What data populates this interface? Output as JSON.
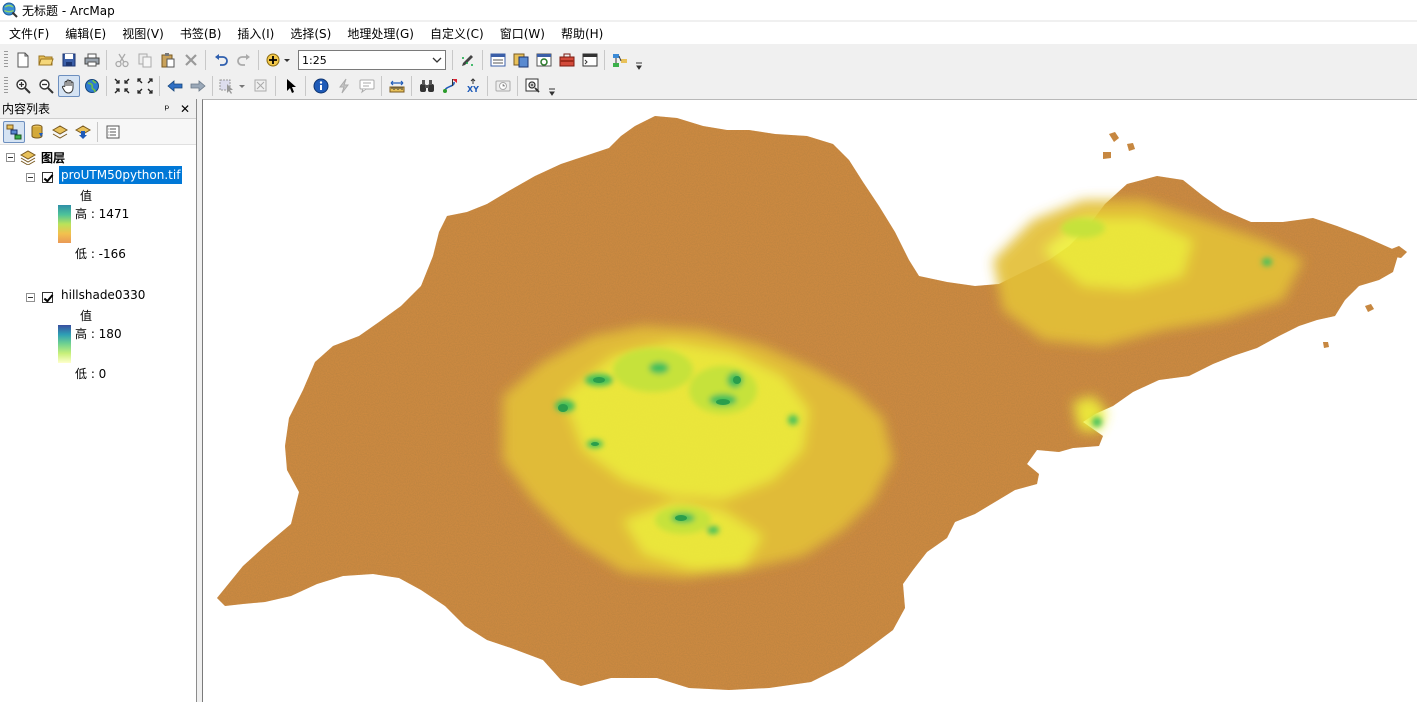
{
  "window": {
    "title": "无标题 - ArcMap"
  },
  "menu": [
    "文件(F)",
    "编辑(E)",
    "视图(V)",
    "书签(B)",
    "插入(I)",
    "选择(S)",
    "地理处理(G)",
    "自定义(C)",
    "窗口(W)",
    "帮助(H)"
  ],
  "toolbar": {
    "scale_value": "1:25"
  },
  "toc": {
    "title": "内容列表",
    "pin_glyph": "ᵖ",
    "close_glyph": "✕",
    "root_label": "图层",
    "layers": [
      {
        "name": "proUTM50python.tif",
        "checked": true,
        "selected": true,
        "legend_title": "值",
        "high_label": "高 : 1471",
        "low_label": "低 : -166",
        "ramp_colors": [
          "#2f8fa8",
          "#4dc29a",
          "#b9e35a",
          "#f2c14e",
          "#ea9a56"
        ]
      },
      {
        "name": "hillshade0330",
        "checked": true,
        "selected": false,
        "legend_title": "值",
        "high_label": "高 : 180",
        "low_label": "低 : 0",
        "ramp_colors": [
          "#3a4fa0",
          "#2e9fb5",
          "#72d38f",
          "#c9f07a",
          "#ffffcc"
        ]
      }
    ]
  },
  "map": {
    "background": "#ffffff",
    "land_color": "#d38c43",
    "highland_colors": [
      "#e3c039",
      "#eeee3a",
      "#c6e23a",
      "#3fbf5b",
      "#2a9e4c"
    ]
  }
}
